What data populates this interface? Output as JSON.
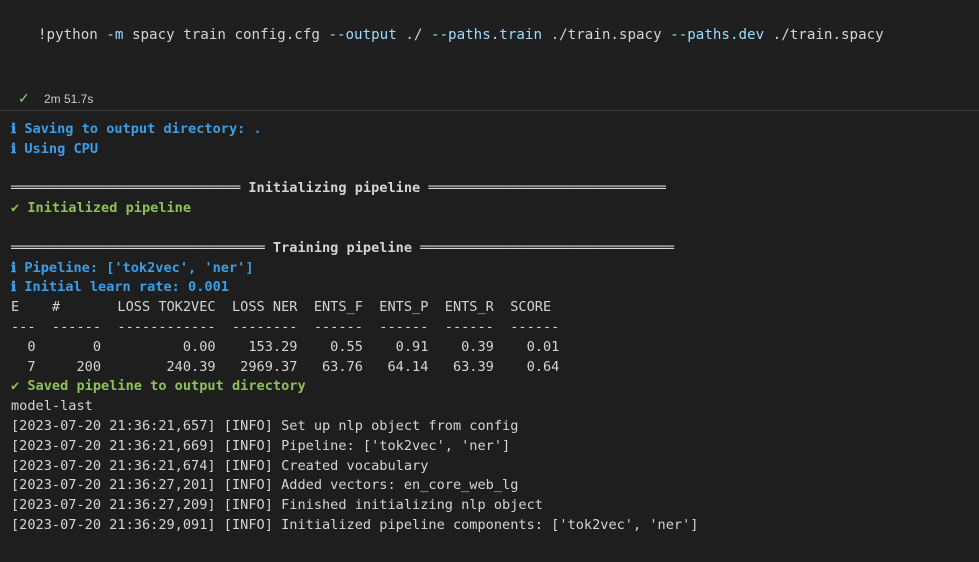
{
  "cell": {
    "command_tokens": [
      {
        "t": "!python",
        "c": "cmd"
      },
      {
        "t": " ",
        "c": "cmd"
      },
      {
        "t": "-m",
        "c": "op"
      },
      {
        "t": " spacy train config.cfg ",
        "c": "cmd"
      },
      {
        "t": "--output",
        "c": "op"
      },
      {
        "t": " ",
        "c": "cmd"
      },
      {
        "t": ".",
        "c": "op"
      },
      {
        "t": "/ ",
        "c": "cmd"
      },
      {
        "t": "--paths.train",
        "c": "op"
      },
      {
        "t": " ",
        "c": "cmd"
      },
      {
        "t": ".",
        "c": "op"
      },
      {
        "t": "/train.spacy ",
        "c": "cmd"
      },
      {
        "t": "--paths.dev",
        "c": "op"
      },
      {
        "t": " ",
        "c": "cmd"
      },
      {
        "t": ".",
        "c": "op"
      },
      {
        "t": "/train.spacy",
        "c": "cmd"
      }
    ],
    "status_icon": "check-icon",
    "duration": "2m 51.7s"
  },
  "output": {
    "lines": [
      {
        "text": "ℹ Saving to output directory: .",
        "style": "info"
      },
      {
        "text": "ℹ Using CPU",
        "style": "info"
      },
      {
        "text": "",
        "style": "tbl"
      },
      {
        "text": "════════════════════════════ Initializing pipeline ═════════════════════════════",
        "style": "hdr"
      },
      {
        "text": "✔ Initialized pipeline",
        "style": "ok"
      },
      {
        "text": "",
        "style": "tbl"
      },
      {
        "text": "═══════════════════════════════ Training pipeline ═══════════════════════════════",
        "style": "hdr"
      },
      {
        "text": "ℹ Pipeline: ['tok2vec', 'ner']",
        "style": "info"
      },
      {
        "text": "ℹ Initial learn rate: 0.001",
        "style": "info"
      },
      {
        "text": "E    #       LOSS TOK2VEC  LOSS NER  ENTS_F  ENTS_P  ENTS_R  SCORE ",
        "style": "tbl"
      },
      {
        "text": "---  ------  ------------  --------  ------  ------  ------  ------",
        "style": "tbl"
      },
      {
        "text": "  0       0          0.00    153.29    0.55    0.91    0.39    0.01",
        "style": "tbl"
      },
      {
        "text": "  7     200        240.39   2969.37   63.76   64.14   63.39    0.64",
        "style": "tbl"
      },
      {
        "text": "✔ Saved pipeline to output directory",
        "style": "ok"
      },
      {
        "text": "model-last",
        "style": "tbl"
      },
      {
        "text": "[2023-07-20 21:36:21,657] [INFO] Set up nlp object from config",
        "style": "tbl"
      },
      {
        "text": "[2023-07-20 21:36:21,669] [INFO] Pipeline: ['tok2vec', 'ner']",
        "style": "tbl"
      },
      {
        "text": "[2023-07-20 21:36:21,674] [INFO] Created vocabulary",
        "style": "tbl"
      },
      {
        "text": "[2023-07-20 21:36:27,201] [INFO] Added vectors: en_core_web_lg",
        "style": "tbl"
      },
      {
        "text": "[2023-07-20 21:36:27,209] [INFO] Finished initializing nlp object",
        "style": "tbl"
      },
      {
        "text": "[2023-07-20 21:36:29,091] [INFO] Initialized pipeline components: ['tok2vec', 'ner']",
        "style": "tbl"
      }
    ]
  },
  "colors": {
    "info": "#3b9ee8",
    "ok": "#8ec15a",
    "text": "#d4d4d4",
    "background": "#1e1e1e"
  }
}
